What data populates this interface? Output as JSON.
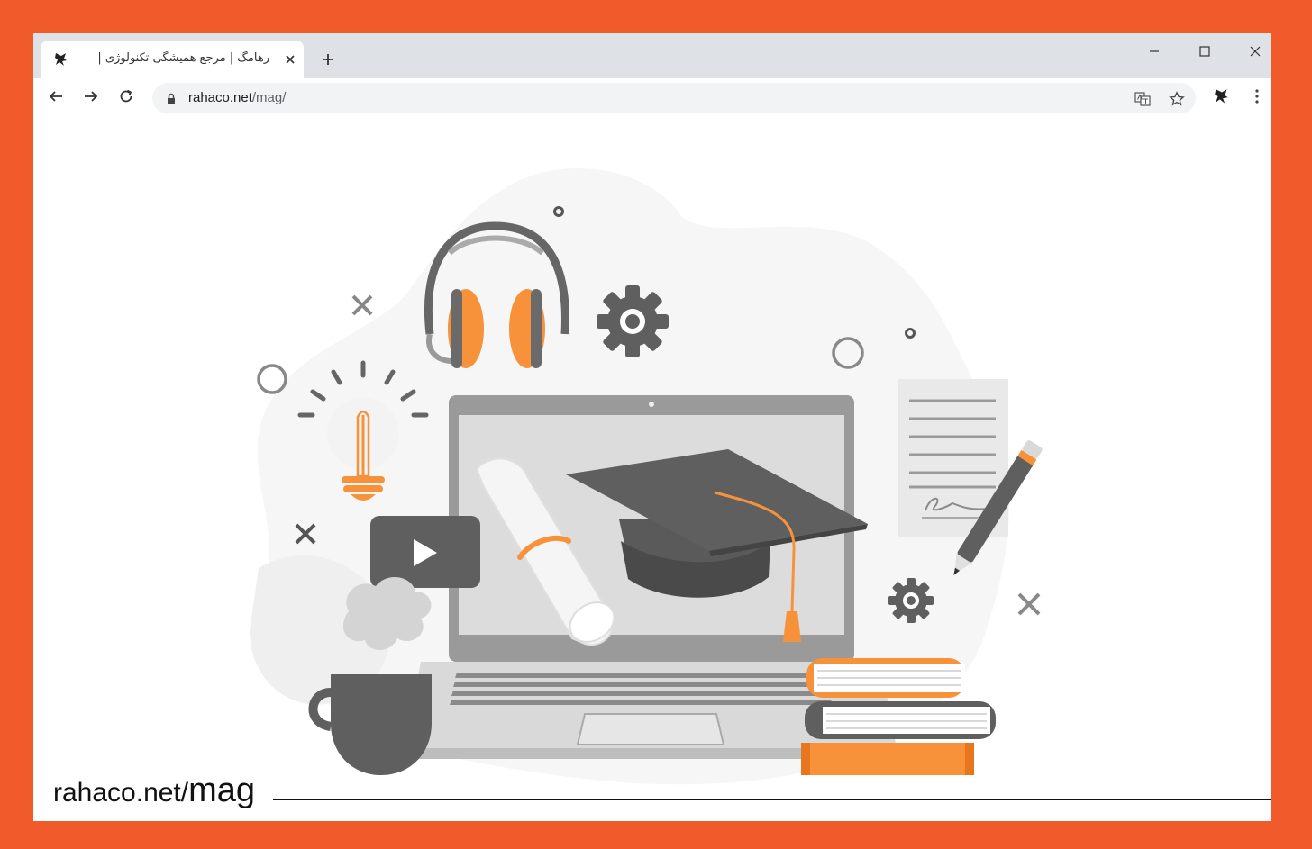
{
  "browser": {
    "tab": {
      "title": "رهامگ | مرجع همیشگی تکنولوژی |",
      "favicon": "rahaco-logo-icon"
    },
    "new_tab_symbol": "+",
    "url": {
      "domain": "rahaco.net",
      "path": "/mag/"
    },
    "icons": [
      "back-icon",
      "forward-icon",
      "reload-icon",
      "lock-icon",
      "translate-icon",
      "star-icon",
      "extension-icon",
      "menu-icon",
      "minimize-icon",
      "maximize-icon",
      "close-icon"
    ]
  },
  "footer": {
    "domain": "rahaco.net/",
    "section": "mag"
  },
  "colors": {
    "frame": "#f15a2b",
    "accent_orange": "#f7923a",
    "dark_gray": "#5f5f5f"
  }
}
